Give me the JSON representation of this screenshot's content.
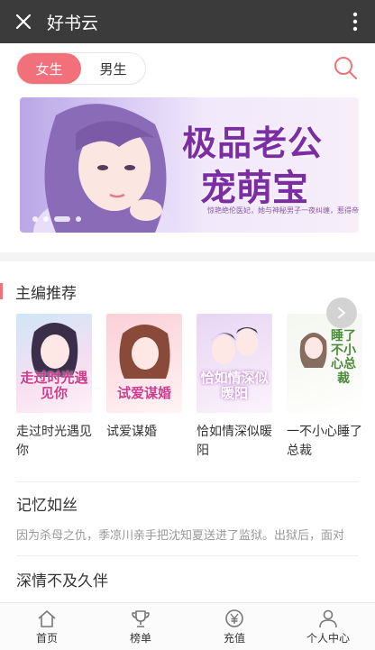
{
  "app": {
    "title": "好书云"
  },
  "tabs": [
    {
      "label": "女生",
      "active": true
    },
    {
      "label": "男生",
      "active": false
    }
  ],
  "banner": {
    "title_line1": "极品老公",
    "title_line2": "宠萌宝",
    "subtitle": "惊艳绝伦医妃，她与神秘男子一夜纠缠，惹得帝后无敌追",
    "slide_count": 4,
    "active_slide": 3
  },
  "editor_pick": {
    "title": "主编推荐",
    "books": [
      {
        "name": "走过时光遇见你",
        "cover_text": "走过时光遇见你"
      },
      {
        "name": "试爱谋婚",
        "cover_text": "试爱谋婚"
      },
      {
        "name": "恰如情深似暖阳",
        "cover_text": "恰如情深似暖阳"
      },
      {
        "name": "一不小心睡了总裁",
        "cover_text": "睡了不小心总裁"
      }
    ]
  },
  "stories": [
    {
      "title": "记忆如丝",
      "desc": "因为杀母之仇，季凉川亲手把沈知夏送进了监狱。出狱后，面对"
    },
    {
      "title": "深情不及久伴",
      "desc": ""
    }
  ],
  "bottom_nav": [
    {
      "label": "首页",
      "icon": "home-icon"
    },
    {
      "label": "榜单",
      "icon": "trophy-icon"
    },
    {
      "label": "充值",
      "icon": "yuan-icon"
    },
    {
      "label": "个人中心",
      "icon": "person-icon"
    }
  ],
  "colors": {
    "accent": "#f1707a",
    "topbar": "#3b3b3b",
    "banner_title": "#7b2da3"
  }
}
